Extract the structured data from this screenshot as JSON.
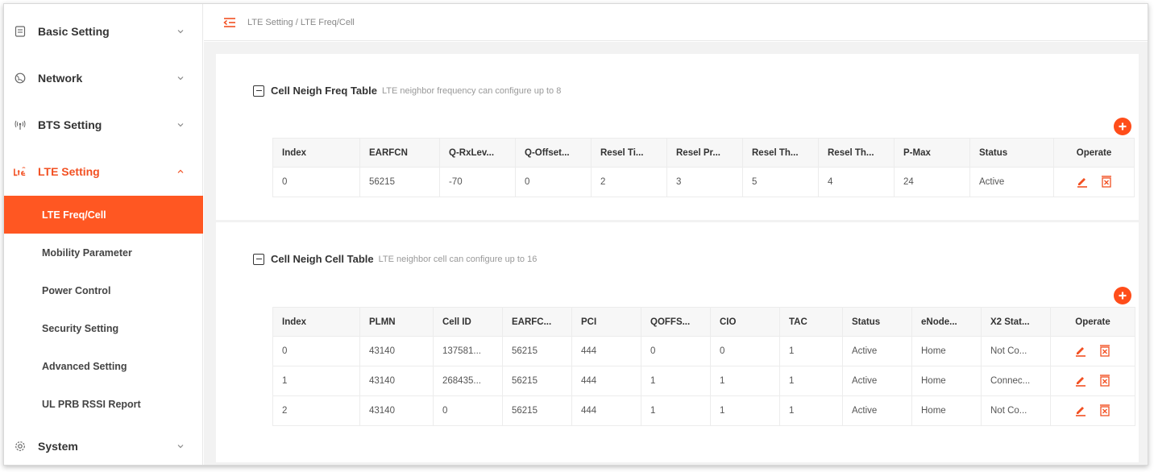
{
  "sidebar": {
    "items": [
      {
        "label": "Basic Setting",
        "icon": "document-icon"
      },
      {
        "label": "Network",
        "icon": "globe-icon"
      },
      {
        "label": "BTS Setting",
        "icon": "antenna-icon"
      },
      {
        "label": "LTE Setting",
        "icon": "lte-icon"
      },
      {
        "label": "System",
        "icon": "gear-icon"
      }
    ],
    "lte_sub_items": [
      "LTE Freq/Cell",
      "Mobility Parameter",
      "Power Control",
      "Security Setting",
      "Advanced Setting",
      "UL PRB RSSI Report"
    ]
  },
  "header": {
    "breadcrumb": "LTE Setting / LTE Freq/Cell"
  },
  "freq_table": {
    "title": "Cell Neigh Freq Table",
    "hint": "LTE neighbor frequency can configure up to 8",
    "columns": [
      "Index",
      "EARFCN",
      "Q-RxLev...",
      "Q-Offset...",
      "Resel Ti...",
      "Resel Pr...",
      "Resel Th...",
      "Resel Th...",
      "P-Max",
      "Status",
      "Operate"
    ],
    "rows": [
      [
        "0",
        "56215",
        "-70",
        "0",
        "2",
        "3",
        "5",
        "4",
        "24",
        "Active"
      ]
    ]
  },
  "cell_table": {
    "title": "Cell Neigh Cell Table",
    "hint": "LTE neighbor cell can configure up to 16",
    "columns": [
      "Index",
      "PLMN",
      "Cell ID",
      "EARFC...",
      "PCI",
      "QOFFS...",
      "CIO",
      "TAC",
      "Status",
      "eNode...",
      "X2 Stat...",
      "Operate"
    ],
    "rows": [
      [
        "0",
        "43140",
        "137581...",
        "56215",
        "444",
        "0",
        "0",
        "1",
        "Active",
        "Home",
        "Not Co..."
      ],
      [
        "1",
        "43140",
        "268435...",
        "56215",
        "444",
        "1",
        "1",
        "1",
        "Active",
        "Home",
        "Connec..."
      ],
      [
        "2",
        "43140",
        "0",
        "56215",
        "444",
        "1",
        "1",
        "1",
        "Active",
        "Home",
        "Not Co..."
      ]
    ]
  },
  "colors": {
    "accent": "#ff5722",
    "add_button": "#ff4d1a"
  }
}
